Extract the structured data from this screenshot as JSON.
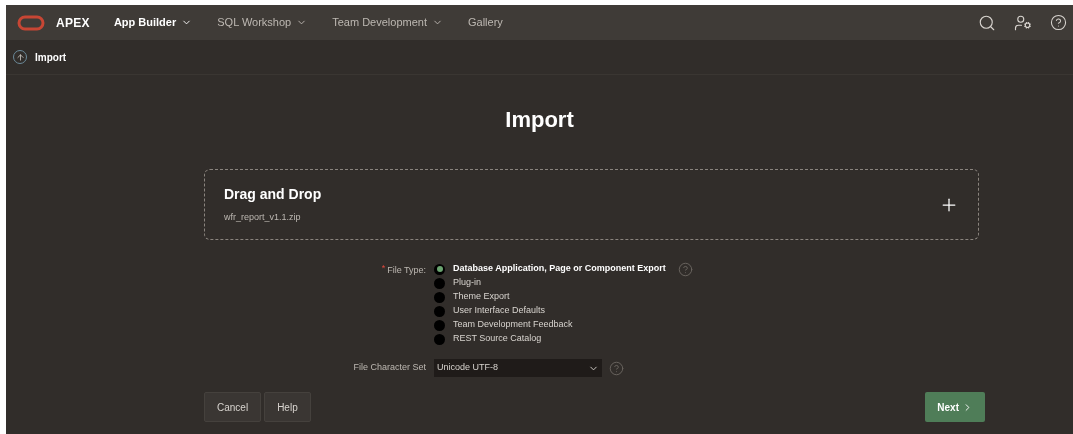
{
  "nav": {
    "brand": "APEX",
    "items": [
      {
        "label": "App Builder",
        "selected": true,
        "dropdown": true
      },
      {
        "label": "SQL Workshop",
        "selected": false,
        "dropdown": true
      },
      {
        "label": "Team Development",
        "selected": false,
        "dropdown": true
      },
      {
        "label": "Gallery",
        "selected": false,
        "dropdown": false
      }
    ]
  },
  "breadcrumb": "Import",
  "page_title": "Import",
  "drop_zone": {
    "title": "Drag and Drop",
    "file": "wfr_report_v1.1.zip"
  },
  "file_type": {
    "label": "File Type:",
    "required_marker": "*",
    "options": [
      {
        "label": "Database Application, Page or Component Export",
        "selected": true
      },
      {
        "label": "Plug-in",
        "selected": false
      },
      {
        "label": "Theme Export",
        "selected": false
      },
      {
        "label": "User Interface Defaults",
        "selected": false
      },
      {
        "label": "Team Development Feedback",
        "selected": false
      },
      {
        "label": "REST Source Catalog",
        "selected": false
      }
    ]
  },
  "character_set": {
    "label": "File Character Set",
    "value": "Unicode UTF-8"
  },
  "buttons": {
    "cancel": "Cancel",
    "help": "Help",
    "next": "Next"
  }
}
